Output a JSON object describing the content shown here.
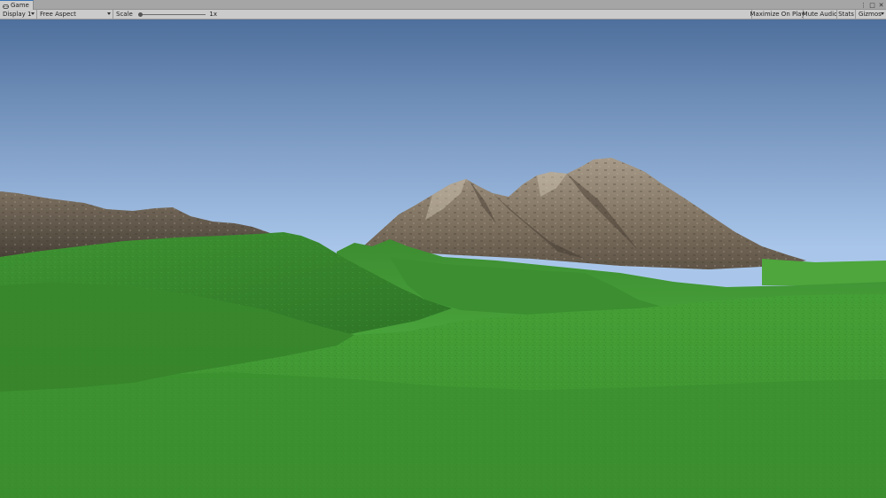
{
  "tab": {
    "label": "Game",
    "icon": "gamepad-icon"
  },
  "window_controls": {
    "menu_glyph": "⋮",
    "maximize_glyph": "□",
    "close_glyph": "✕"
  },
  "toolbar": {
    "display_label": "Display 1",
    "aspect_label": "Free Aspect",
    "scale_label": "Scale",
    "scale_value": "1x",
    "scale_slider_fraction": 0,
    "maximize_label": "Maximize On Play",
    "mute_label": "Mute Audio",
    "stats_label": "Stats",
    "gizmos_label": "Gizmos"
  },
  "scene": {
    "sky_top_color": "#4f6f9c",
    "sky_horizon_color": "#a9c6ea",
    "grass_color": "#3f9a33",
    "grass_dark_color": "#2f7a28",
    "rock_color": "#8d7f6e",
    "rock_dark_color": "#5e5447"
  }
}
